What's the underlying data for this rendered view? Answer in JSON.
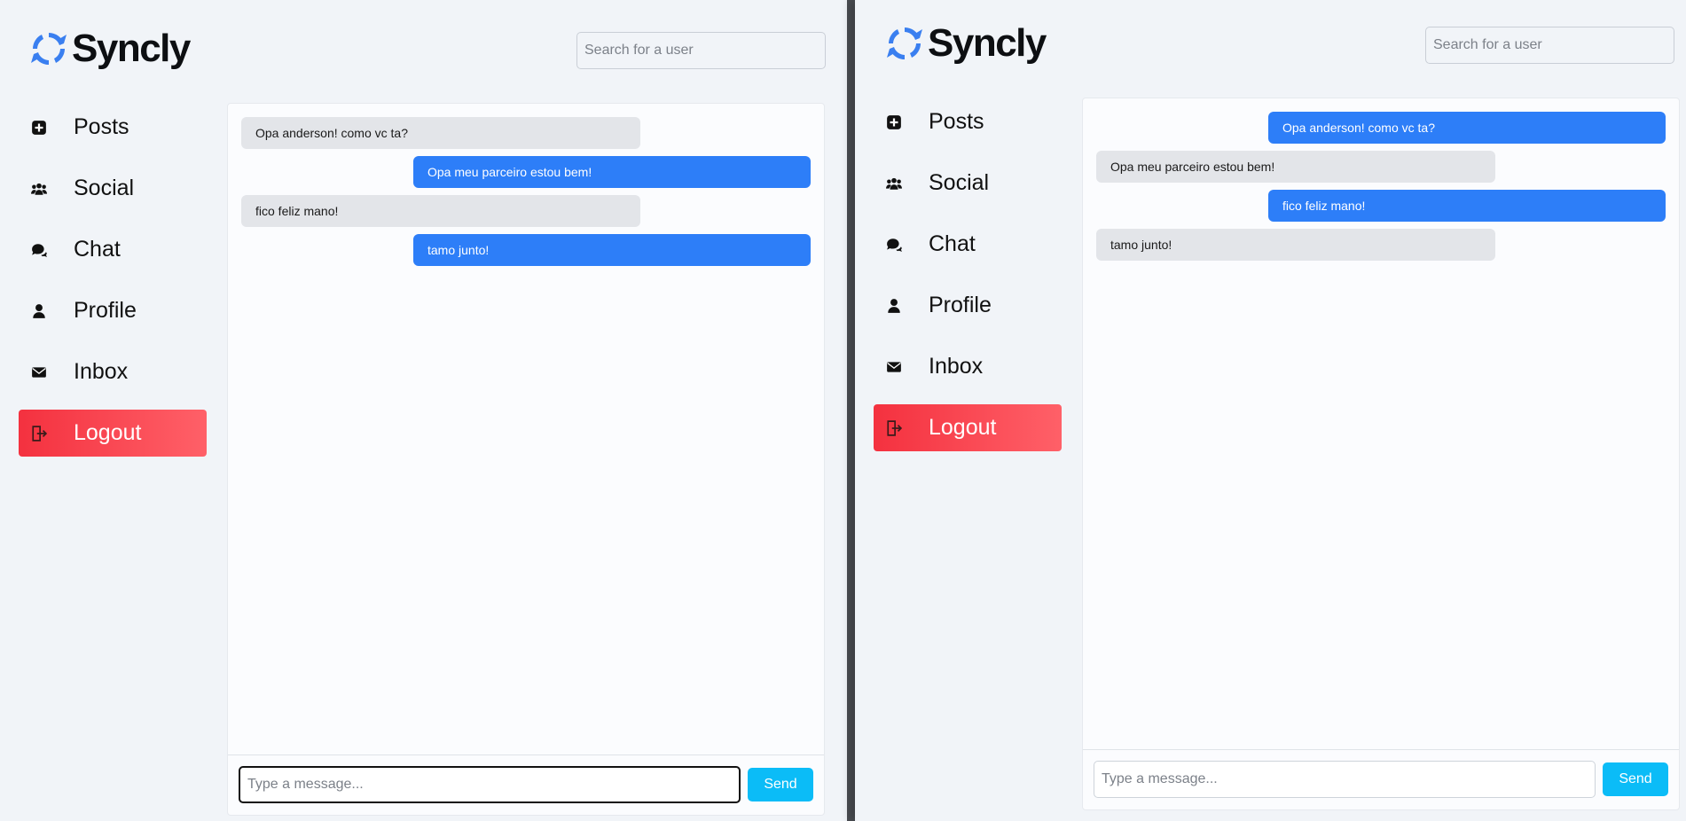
{
  "left": {
    "brand": {
      "name": "Syncly"
    },
    "search": {
      "placeholder": "Search for a user"
    },
    "nav": [
      {
        "label": "Posts",
        "icon": "plus-square-icon"
      },
      {
        "label": "Social",
        "icon": "users-icon"
      },
      {
        "label": "Chat",
        "icon": "chat-bubbles-icon"
      },
      {
        "label": "Profile",
        "icon": "user-icon"
      },
      {
        "label": "Inbox",
        "icon": "envelope-icon"
      },
      {
        "label": "Logout",
        "icon": "logout-icon"
      }
    ],
    "messages": [
      {
        "text": "Opa anderson! como vc ta?",
        "direction": "incoming"
      },
      {
        "text": "Opa meu parceiro estou bem!",
        "direction": "outgoing"
      },
      {
        "text": "fico feliz mano!",
        "direction": "incoming"
      },
      {
        "text": "tamo junto!",
        "direction": "outgoing"
      }
    ],
    "composer": {
      "placeholder": "Type a message...",
      "send_label": "Send"
    }
  },
  "right": {
    "brand": {
      "name": "Syncly"
    },
    "search": {
      "placeholder": "Search for a user"
    },
    "nav": [
      {
        "label": "Posts",
        "icon": "plus-square-icon"
      },
      {
        "label": "Social",
        "icon": "users-icon"
      },
      {
        "label": "Chat",
        "icon": "chat-bubbles-icon"
      },
      {
        "label": "Profile",
        "icon": "user-icon"
      },
      {
        "label": "Inbox",
        "icon": "envelope-icon"
      },
      {
        "label": "Logout",
        "icon": "logout-icon"
      }
    ],
    "messages": [
      {
        "text": "Opa anderson! como vc ta?",
        "direction": "outgoing"
      },
      {
        "text": "Opa meu parceiro estou bem!",
        "direction": "incoming"
      },
      {
        "text": "fico feliz mano!",
        "direction": "outgoing"
      },
      {
        "text": "tamo junto!",
        "direction": "incoming"
      }
    ],
    "composer": {
      "placeholder": "Type a message...",
      "send_label": "Send"
    }
  },
  "colors": {
    "accent_blue": "#2d7ef8",
    "send_button": "#0bbcf7",
    "logout_red": "#f4313f",
    "incoming_bubble": "#e3e5e9",
    "page_bg": "#f1f4f8"
  }
}
